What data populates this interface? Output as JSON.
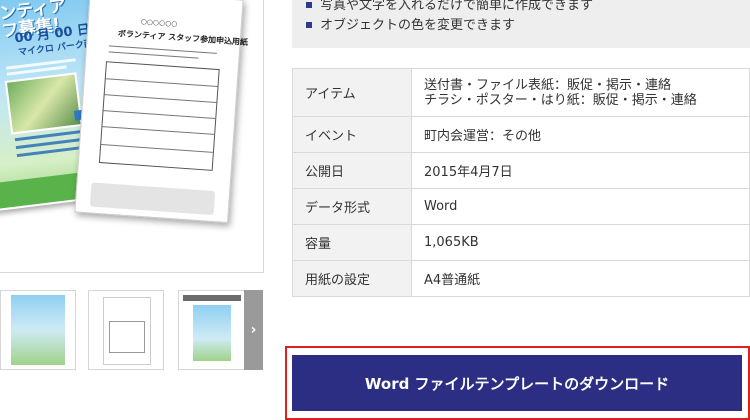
{
  "features": [
    "写真や文字を入れるだけで簡単に作成できます",
    "オブジェクトの色を変更できます"
  ],
  "preview": {
    "flyer_title": "ンティア\nフ募集!",
    "flyer_date": "00 月 00 日(日)",
    "flyer_sub": "マイクロ パーク西棟",
    "form_circles": "○○○○○○",
    "form_title": "ボランティア スタッフ参加申込用紙"
  },
  "details": [
    {
      "label": "アイテム",
      "lines": [
        "送付書・ファイル表紙：販促・掲示・連絡",
        "チラシ・ポスター・はり紙：販促・掲示・連絡"
      ]
    },
    {
      "label": "イベント",
      "lines": [
        "町内会運営：その他"
      ]
    },
    {
      "label": "公開日",
      "lines": [
        "2015年4月7日"
      ]
    },
    {
      "label": "データ形式",
      "lines": [
        "Word"
      ]
    },
    {
      "label": "容量",
      "lines": [
        "1,065KB"
      ]
    },
    {
      "label": "用紙の設定",
      "lines": [
        "A4普通紙"
      ]
    }
  ],
  "download": {
    "label": "Word ファイルテンプレートのダウンロード"
  },
  "icons": {
    "bullet": "square-bullet-icon",
    "next": "chevron-right-icon"
  },
  "colors": {
    "accent": "#2b2e82",
    "highlight": "#e02020"
  }
}
